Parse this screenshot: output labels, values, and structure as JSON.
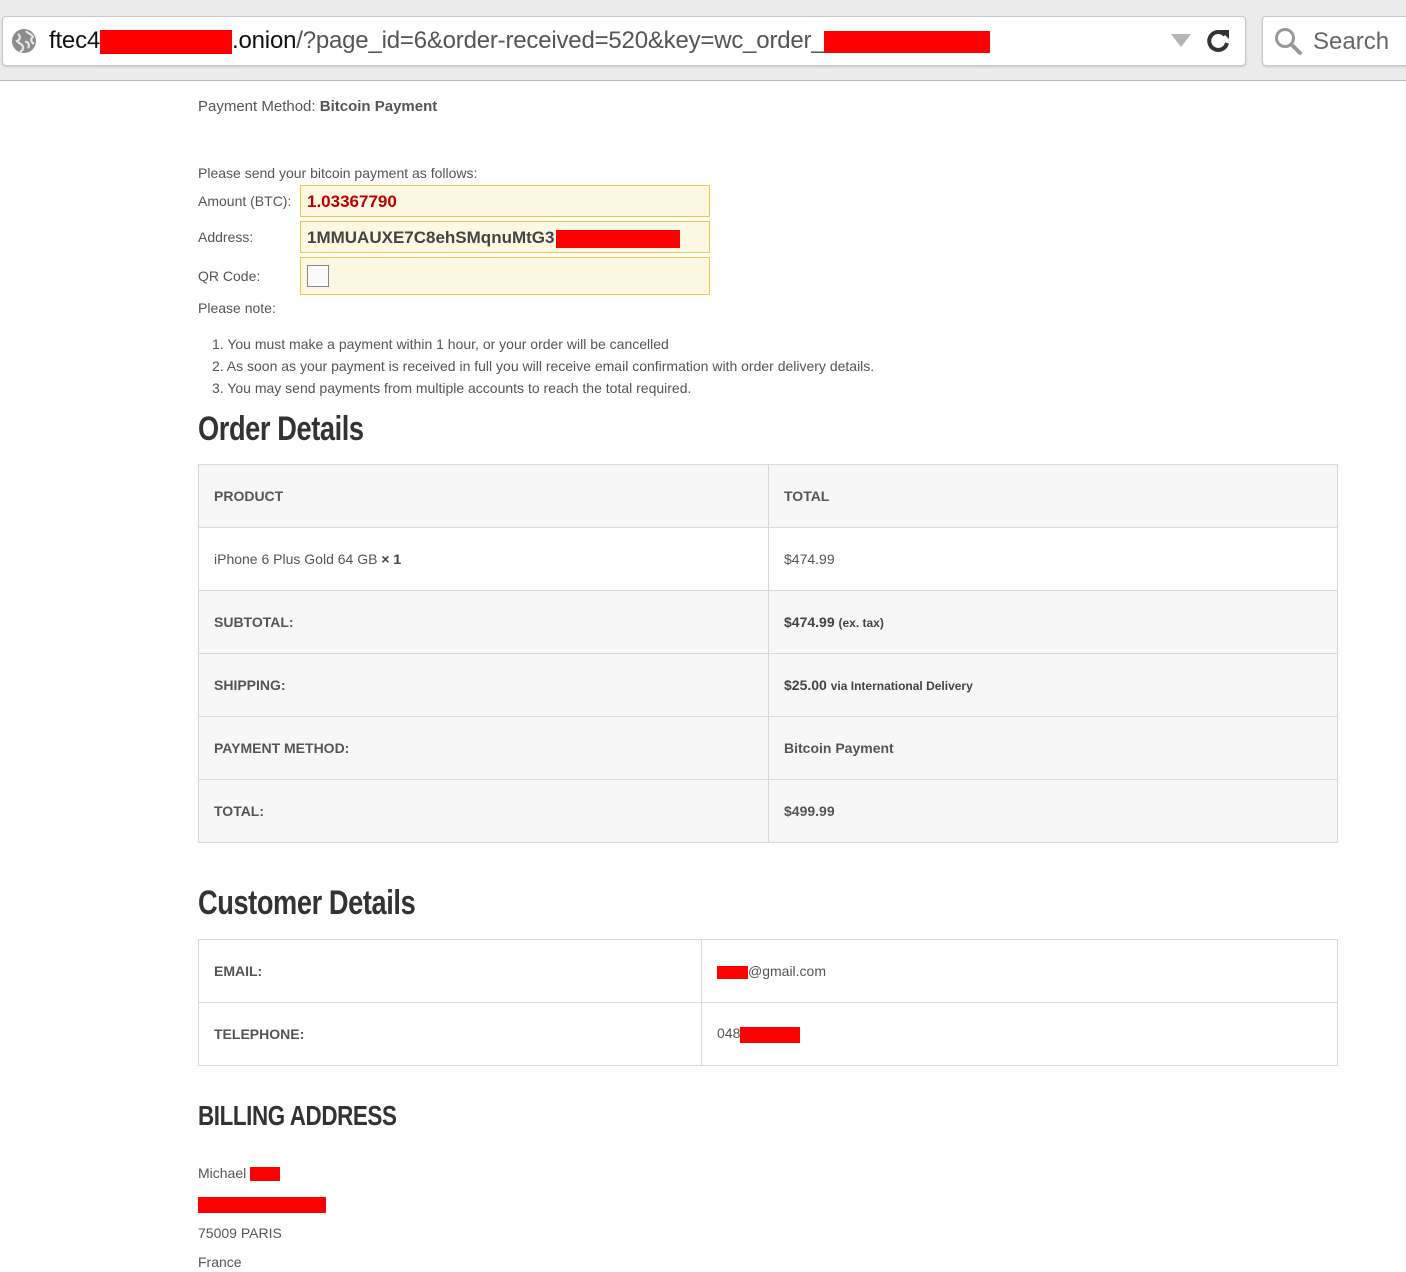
{
  "browser": {
    "url_host_start": "ftec4",
    "url_host_end": ".onion",
    "url_path": "/?page_id=6&order-received=520&key=wc_order_",
    "search_placeholder": "Search"
  },
  "payment": {
    "method_label": "Payment Method:",
    "method_value": "Bitcoin Payment",
    "intro": "Please send your bitcoin payment as follows:",
    "amount_label": "Amount (BTC):",
    "amount_value": "1.03367790",
    "address_label": "Address:",
    "address_value": "1MMUAUXE7C8ehSMqnuMtG3",
    "qr_label": "QR Code:",
    "note_label": "Please note:",
    "notes": [
      "1. You must make a payment within 1 hour, or your order will be cancelled",
      "2. As soon as your payment is received in full you will receive email confirmation with order delivery details.",
      "3. You may send payments from multiple accounts to reach the total required."
    ]
  },
  "order": {
    "heading": "Order Details",
    "col_product": "PRODUCT",
    "col_total": "TOTAL",
    "item_name": "iPhone 6 Plus Gold 64 GB",
    "item_qty": "× 1",
    "item_total": "$474.99",
    "subtotal_label": "SUBTOTAL:",
    "subtotal_value": "$474.99",
    "subtotal_note": "(ex. tax)",
    "shipping_label": "SHIPPING:",
    "shipping_value": "$25.00",
    "shipping_note": "via International Delivery",
    "method_label": "PAYMENT METHOD:",
    "method_value": "Bitcoin Payment",
    "total_label": "TOTAL:",
    "total_value": "$499.99"
  },
  "customer": {
    "heading": "Customer Details",
    "email_label": "EMAIL:",
    "email_domain": "@gmail.com",
    "phone_label": "TELEPHONE:",
    "phone_prefix": "048"
  },
  "billing": {
    "heading": "BILLING ADDRESS",
    "name": "Michael",
    "city_line": "75009 PARIS",
    "country": "France"
  },
  "colors": {
    "redaction": "#ff0000",
    "amount": "#c00000",
    "highlight_bg": "#fdf8e1",
    "highlight_border": "#e9c84a"
  }
}
